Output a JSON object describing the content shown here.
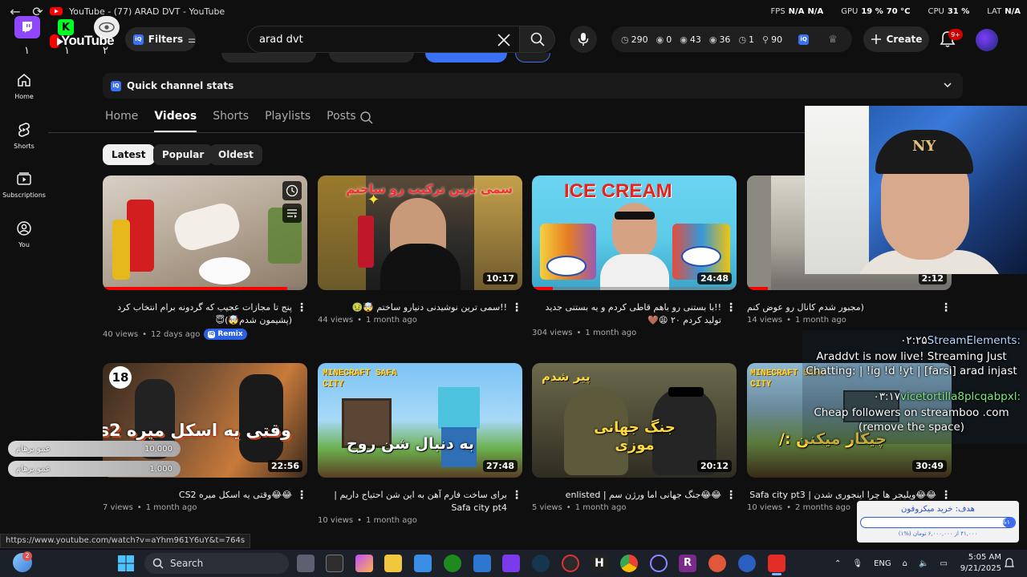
{
  "window": {
    "title": "YouTube - (77) ARAD DVT - YouTube"
  },
  "perf": {
    "fps_label": "FPS",
    "fps_value1": "N/A",
    "fps_value2": "N/A",
    "gpu_label": "GPU",
    "gpu_value": "19 %",
    "gpu_temp": "70 °C",
    "cpu_label": "CPU",
    "cpu_value": "31 %",
    "lat_label": "LAT",
    "lat_value": "N/A"
  },
  "overlay": {
    "num_left": "۱",
    "num_mid": "۱",
    "num_right": "۲"
  },
  "header": {
    "logo": "YouTube",
    "filters_label": "Filters",
    "search_value": "arad dvt",
    "search_placeholder": "Search",
    "stats": [
      "290",
      "0",
      "43",
      "36",
      "1",
      "90"
    ],
    "create_label": "Create",
    "notif_badge": "9+"
  },
  "nav": {
    "home": "Home",
    "shorts": "Shorts",
    "subscriptions": "Subscriptions",
    "you": "You"
  },
  "quick_stats": {
    "label": "Quick channel stats"
  },
  "tabs": [
    "Home",
    "Videos",
    "Shorts",
    "Playlists",
    "Posts"
  ],
  "chips": [
    "Latest",
    "Popular",
    "Oldest"
  ],
  "videos": [
    {
      "title": "پنج تا مجازات عجیب که گردونه برام انتخاب کرد (پشیمون شدم🤯)😇",
      "views": "40 views",
      "age": "12 days ago",
      "badge": "Remix",
      "duration": "",
      "progress": 0.9
    },
    {
      "title": "!!سمی ترین نوشیدنی دنیارو ساختم 🤯🤢",
      "views": "44 views",
      "age": "1 month ago",
      "duration": "10:17",
      "progress": 0.55,
      "thumb_text": "سمی ترین ترکیب رو ساختم"
    },
    {
      "title": "!!با بستنی رو باهم قاطی کردم و یه بستنی جدید تولید کردم ۲۰ 😩🤎",
      "views": "304 views",
      "age": "1 month ago",
      "duration": "24:48",
      "progress": 0.1,
      "thumb_text": "ICE CREAM"
    },
    {
      "title": "(مجبور شدم کانال رو عوض کنم",
      "views": "14 views",
      "age": "1 month ago",
      "duration": "2:12",
      "progress": 0.1
    },
    {
      "title": "😂😂وقتی یه اسکل میره CS2",
      "views": "7 views",
      "age": "1 month ago",
      "duration": "22:56",
      "progress": 0,
      "thumb_text": "وقتی یه اسکل میره cs2",
      "thumb_badge": "18"
    },
    {
      "title": "برای ساخت فارم آهن به این شن احتیاج داریم | Safa city pt4",
      "views": "10 views",
      "age": "1 month ago",
      "duration": "27:48",
      "progress": 0,
      "thumb_text": "به دنبال شن روح",
      "thumb_top": "MINECRAFT SAFA CITY"
    },
    {
      "title": "😂😂جنگ جهانی اما ورژن سم | enlisted",
      "views": "5 views",
      "age": "1 month ago",
      "duration": "20:12",
      "progress": 0,
      "thumb_text": "جنگ جهانی موزی",
      "thumb_top": "پیر شدم"
    },
    {
      "title": "😂😂ویلیجر ها چرا اینجوری شدن | Safa city pt3",
      "views": "10 views",
      "age": "2 months ago",
      "duration": "30:49",
      "progress": 0,
      "thumb_text": "چیکار میکنن :/",
      "thumb_top": "MINECRAFT SAFA CITY"
    }
  ],
  "chat": {
    "user1": "StreamElements:",
    "time1": "۰۲:۲۵",
    "msg1": "Araddvt is now live! Streaming Just Chatting: | !ig !d !yt | [farsi] arad injast",
    "user2": "vicetortilla8plcqabpxl:",
    "time2": "۰۳:۱۷",
    "msg2": "Cheap followers on streamboo .com (remove the space)"
  },
  "goal": {
    "title": "هدف: خرید میکروفون",
    "percent": "%۱",
    "fill": 0.08,
    "sub": "۴۱,۰۰۰ از ۶,۰۰۰,۰۰۰ تومان (%۱)"
  },
  "donors": [
    {
      "name": "عمو پرهام",
      "amount": "10,000"
    },
    {
      "name": "عمو پرهام",
      "amount": "1,000"
    }
  ],
  "status_url": "https://www.youtube.com/watch?v=aYhm961Y6uY&t=764s",
  "taskbar": {
    "search": "Search",
    "lang": "ENG",
    "time": "5:05 AM",
    "date": "9/21/2025",
    "badge": "2"
  },
  "colors": {
    "accent_red": "#ff0000",
    "twitch": "#9146ff",
    "kick": "#00ff22",
    "tool_blue": "#3b72f5"
  }
}
